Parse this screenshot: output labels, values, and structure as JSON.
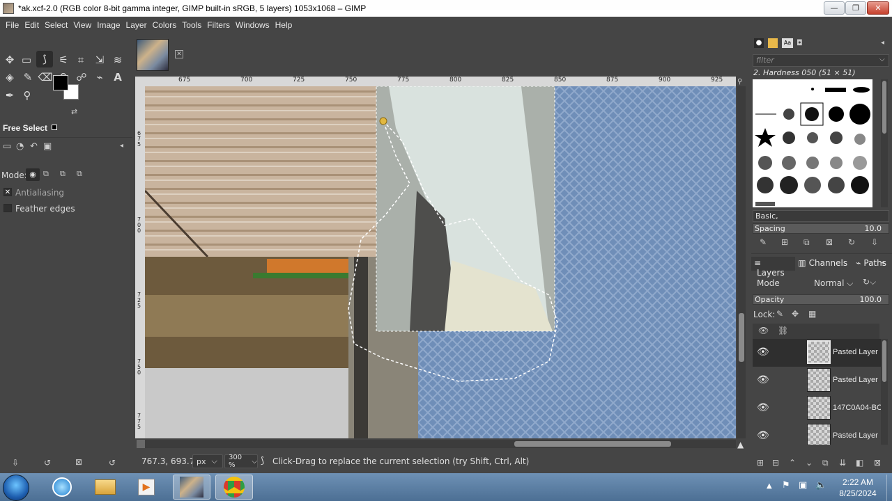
{
  "window": {
    "title": "*ak.xcf-2.0 (RGB color 8-bit gamma integer, GIMP built-in sRGB, 5 layers) 1053x1068 – GIMP",
    "controls": {
      "minimize": "—",
      "maximize": "❐",
      "close": "✕"
    }
  },
  "menu": [
    "File",
    "Edit",
    "Select",
    "View",
    "Image",
    "Layer",
    "Colors",
    "Tools",
    "Filters",
    "Windows",
    "Help"
  ],
  "toolbox": {
    "tools_row1": [
      "move-icon",
      "rect-select-icon",
      "free-select-icon",
      "fuzzy-select-icon",
      "crop-icon",
      "unified-transform-icon",
      "warp-icon"
    ],
    "tools_row2": [
      "bucket-fill-icon",
      "paintbrush-icon",
      "eraser-icon",
      "clone-icon",
      "smudge-icon",
      "paths-icon",
      "text-icon"
    ],
    "tools_row3": [
      "color-picker-icon",
      "zoom-icon"
    ],
    "active_tool": "free-select-icon",
    "fg_color": "#000000",
    "bg_color": "#ffffff"
  },
  "tool_options": {
    "title": "Free Select",
    "mode_label": "Mode:",
    "antialiasing": {
      "label": "Antialiasing",
      "checked": true
    },
    "feather": {
      "label": "Feather edges",
      "checked": false
    }
  },
  "ruler": {
    "h_ticks": [
      "675",
      "700",
      "725",
      "750",
      "775",
      "800",
      "825",
      "850",
      "875",
      "900",
      "925"
    ],
    "v_ticks": [
      "675",
      "700",
      "725",
      "750",
      "775"
    ]
  },
  "status": {
    "coords": "767.3, 693.7",
    "unit": "px",
    "zoom": "300 %",
    "message": "Click-Drag to replace the current selection (try Shift, Ctrl, Alt)"
  },
  "brushes": {
    "filter_placeholder": "filter",
    "current": "2. Hardness 050 (51 × 51)",
    "preset": "Basic,",
    "spacing_label": "Spacing",
    "spacing_value": "10.0"
  },
  "layers": {
    "tabs": [
      "Layers",
      "Channels",
      "Paths"
    ],
    "mode_label": "Mode",
    "mode_value": "Normal",
    "opacity_label": "Opacity",
    "opacity_value": "100.0",
    "lock_label": "Lock:",
    "items": [
      {
        "name": "Pasted Layer",
        "visible": true,
        "selected": true
      },
      {
        "name": "Pasted Layer",
        "visible": true,
        "selected": false
      },
      {
        "name": "147C0A04-BC",
        "visible": true,
        "selected": false
      },
      {
        "name": "Pasted Layer",
        "visible": true,
        "selected": false
      }
    ]
  },
  "taskbar": {
    "time": "2:22 AM",
    "date": "8/25/2024"
  }
}
